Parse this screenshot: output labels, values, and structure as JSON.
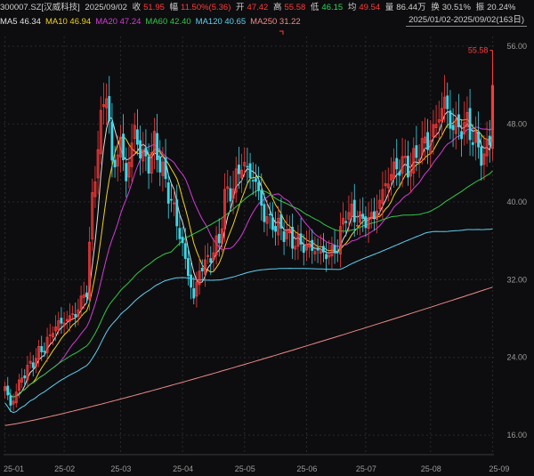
{
  "header": {
    "symbol": "300007.SZ[汉威科技]",
    "date": "2025/09/02",
    "close_label": "收",
    "close": "51.95",
    "change_label": "幅",
    "change": "11.50%(5.36)",
    "open_label": "开",
    "open": "47.42",
    "high_label": "高",
    "high": "55.58",
    "low_label": "低",
    "low": "46.15",
    "avg_label": "均",
    "avg": "49.54",
    "vol_label": "量",
    "vol": "86.44万",
    "turnover_label": "换",
    "turnover": "30.51%",
    "amp_label": "振",
    "amp": "20.24%"
  },
  "range": "2025/01/02-2025/09/02(163日)",
  "ma_legend": [
    {
      "label": "MA5 46.34",
      "color": "#e0e0e0"
    },
    {
      "label": "MA10 46.94",
      "color": "#f2d21b"
    },
    {
      "label": "MA20 47.24",
      "color": "#d43bd6"
    },
    {
      "label": "MA60 42.40",
      "color": "#34c64a"
    },
    {
      "label": "MA120 40.65",
      "color": "#5fd0f0"
    },
    {
      "label": "MA250 31.22",
      "color": "#ef8a8a"
    }
  ],
  "colors": {
    "up": "#ff3b3b",
    "down": "#3fd6e8",
    "grid": "#2a2a2e",
    "axis": "#9a9a9a",
    "bg": "#0d0d0f"
  },
  "chart_data": {
    "type": "candlestick",
    "ylim": [
      14,
      57
    ],
    "y_ticks": [
      "56.00",
      "48.00",
      "40.00",
      "32.00",
      "24.00",
      "16.00"
    ],
    "x_ticks": [
      "25-01",
      "25-02",
      "25-03",
      "25-04",
      "25-05",
      "25-06",
      "25-07",
      "25-08",
      "25-09"
    ],
    "high_annotation": "55.58",
    "anchors": [
      [
        "2025-01-02",
        21.0
      ],
      [
        "2025-01-06",
        19.0
      ],
      [
        "2025-01-10",
        22.0
      ],
      [
        "2025-01-17",
        24.0
      ],
      [
        "2025-01-24",
        26.0
      ],
      [
        "2025-01-27",
        27.0
      ],
      [
        "2025-02-06",
        28.5
      ],
      [
        "2025-02-12",
        31.0
      ],
      [
        "2025-02-14",
        40.0
      ],
      [
        "2025-02-18",
        46.0
      ],
      [
        "2025-02-21",
        52.0
      ],
      [
        "2025-02-25",
        43.5
      ],
      [
        "2025-02-28",
        46.0
      ],
      [
        "2025-03-04",
        42.5
      ],
      [
        "2025-03-07",
        47.5
      ],
      [
        "2025-03-11",
        45.0
      ],
      [
        "2025-03-14",
        44.0
      ],
      [
        "2025-03-18",
        46.0
      ],
      [
        "2025-03-21",
        43.0
      ],
      [
        "2025-03-25",
        41.0
      ],
      [
        "2025-03-28",
        38.0
      ],
      [
        "2025-04-02",
        34.0
      ],
      [
        "2025-04-07",
        30.0
      ],
      [
        "2025-04-09",
        33.0
      ],
      [
        "2025-04-14",
        34.0
      ],
      [
        "2025-04-18",
        36.0
      ],
      [
        "2025-04-22",
        40.5
      ],
      [
        "2025-04-25",
        41.5
      ],
      [
        "2025-04-30",
        44.0
      ],
      [
        "2025-05-07",
        42.0
      ],
      [
        "2025-05-12",
        38.5
      ],
      [
        "2025-05-16",
        37.5
      ],
      [
        "2025-05-21",
        37.0
      ],
      [
        "2025-05-26",
        36.0
      ],
      [
        "2025-05-30",
        35.5
      ],
      [
        "2025-06-06",
        35.0
      ],
      [
        "2025-06-12",
        34.5
      ],
      [
        "2025-06-17",
        35.5
      ],
      [
        "2025-06-20",
        39.0
      ],
      [
        "2025-06-25",
        38.5
      ],
      [
        "2025-06-30",
        38.0
      ],
      [
        "2025-07-04",
        38.5
      ],
      [
        "2025-07-09",
        41.0
      ],
      [
        "2025-07-14",
        43.0
      ],
      [
        "2025-07-18",
        44.0
      ],
      [
        "2025-07-23",
        43.5
      ],
      [
        "2025-07-28",
        45.5
      ],
      [
        "2025-08-01",
        46.5
      ],
      [
        "2025-08-05",
        48.0
      ],
      [
        "2025-08-08",
        50.5
      ],
      [
        "2025-08-12",
        48.0
      ],
      [
        "2025-08-15",
        47.5
      ],
      [
        "2025-08-20",
        48.0
      ],
      [
        "2025-08-25",
        46.0
      ],
      [
        "2025-08-28",
        44.5
      ],
      [
        "2025-09-01",
        46.59
      ],
      [
        "2025-09-02",
        51.95
      ]
    ],
    "series": [
      {
        "name": "MA5",
        "last": 46.34
      },
      {
        "name": "MA10",
        "last": 46.94
      },
      {
        "name": "MA20",
        "last": 47.24
      },
      {
        "name": "MA60",
        "last": 42.4
      },
      {
        "name": "MA120",
        "last": 40.65
      },
      {
        "name": "MA250",
        "last": 31.22
      }
    ]
  }
}
